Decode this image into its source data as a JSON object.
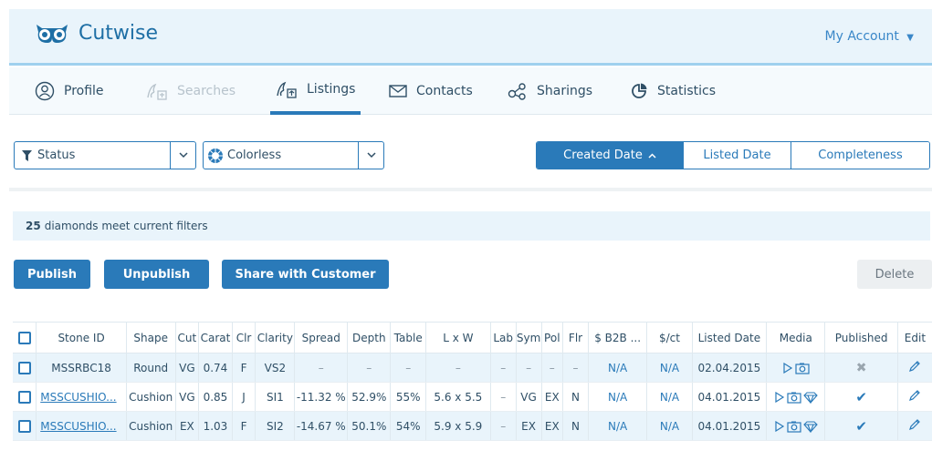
{
  "app": {
    "brand": "Cutwise",
    "account_label": "My Account"
  },
  "colors": {
    "accent": "#2a7ab9",
    "header_bg": "#e9f4fb",
    "row_alt": "#e9f4fb"
  },
  "nav": {
    "items": [
      {
        "label": "Profile",
        "icon": "user-circle-icon",
        "state": "normal"
      },
      {
        "label": "Searches",
        "icon": "search-users-icon",
        "state": "disabled"
      },
      {
        "label": "Listings",
        "icon": "listings-icon",
        "state": "active"
      },
      {
        "label": "Contacts",
        "icon": "envelope-icon",
        "state": "normal"
      },
      {
        "label": "Sharings",
        "icon": "share-icon",
        "state": "normal"
      },
      {
        "label": "Statistics",
        "icon": "pie-chart-icon",
        "state": "normal"
      }
    ]
  },
  "filters": {
    "status": {
      "label": "Status",
      "icon": "filter-icon"
    },
    "color": {
      "label": "Colorless",
      "icon": "diamond-color-icon"
    }
  },
  "sort": {
    "options": [
      {
        "label": "Created Date",
        "active": true,
        "direction": "up"
      },
      {
        "label": "Listed Date",
        "active": false
      },
      {
        "label": "Completeness",
        "active": false
      }
    ]
  },
  "info": {
    "count": "25",
    "text": "diamonds meet current filters"
  },
  "actions": {
    "publish": "Publish",
    "unpublish": "Unpublish",
    "share": "Share with Customer",
    "delete": "Delete"
  },
  "table": {
    "columns": [
      "Stone ID",
      "Shape",
      "Cut",
      "Carat",
      "Clr",
      "Clarity",
      "Spread",
      "Depth",
      "Table",
      "L x W",
      "Lab",
      "Sym",
      "Pol",
      "Flr",
      "$ B2B ...",
      "$/ct",
      "Listed Date",
      "Media",
      "Published",
      "Edit"
    ],
    "rows": [
      {
        "stone_id": "MSSRBC18",
        "link": false,
        "shape": "Round",
        "cut": "VG",
        "carat": "0.74",
        "clr": "F",
        "clarity": "VS2",
        "spread": "–",
        "depth": "–",
        "table": "–",
        "lxw": "–",
        "lab": "–",
        "sym": "–",
        "pol": "–",
        "flr": "–",
        "b2b": "N/A",
        "perct": "N/A",
        "listed": "02.04.2015",
        "media": [
          "play-icon",
          "camera-icon"
        ],
        "published": "no"
      },
      {
        "stone_id": "MSSCUSHIO...",
        "link": true,
        "shape": "Cushion",
        "cut": "VG",
        "carat": "0.85",
        "clr": "J",
        "clarity": "SI1",
        "spread": "-11.32 %",
        "depth": "52.9%",
        "table": "55%",
        "lxw": "5.6 x 5.5",
        "lab": "–",
        "sym": "VG",
        "pol": "EX",
        "flr": "N",
        "b2b": "N/A",
        "perct": "N/A",
        "listed": "04.01.2015",
        "media": [
          "play-icon",
          "camera-icon",
          "diamond-icon"
        ],
        "published": "yes"
      },
      {
        "stone_id": "MSSCUSHIO...",
        "link": true,
        "shape": "Cushion",
        "cut": "EX",
        "carat": "1.03",
        "clr": "F",
        "clarity": "SI2",
        "spread": "-14.67 %",
        "depth": "50.1%",
        "table": "54%",
        "lxw": "5.9 x 5.9",
        "lab": "–",
        "sym": "EX",
        "pol": "EX",
        "flr": "N",
        "b2b": "N/A",
        "perct": "N/A",
        "listed": "04.01.2015",
        "media": [
          "play-icon",
          "camera-icon",
          "diamond-icon"
        ],
        "published": "yes"
      }
    ]
  }
}
